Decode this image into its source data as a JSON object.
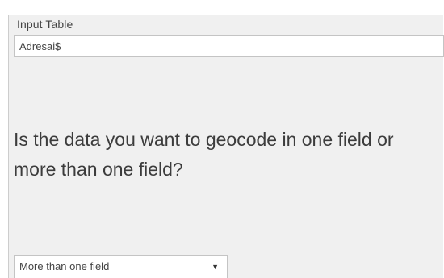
{
  "input_table": {
    "label": "Input Table",
    "value": "Adresai$"
  },
  "question": {
    "text": "Is the data you want to geocode in one field or more than one field?"
  },
  "field_mode": {
    "selected": "More than one field",
    "icon": "chevron-down-icon"
  }
}
